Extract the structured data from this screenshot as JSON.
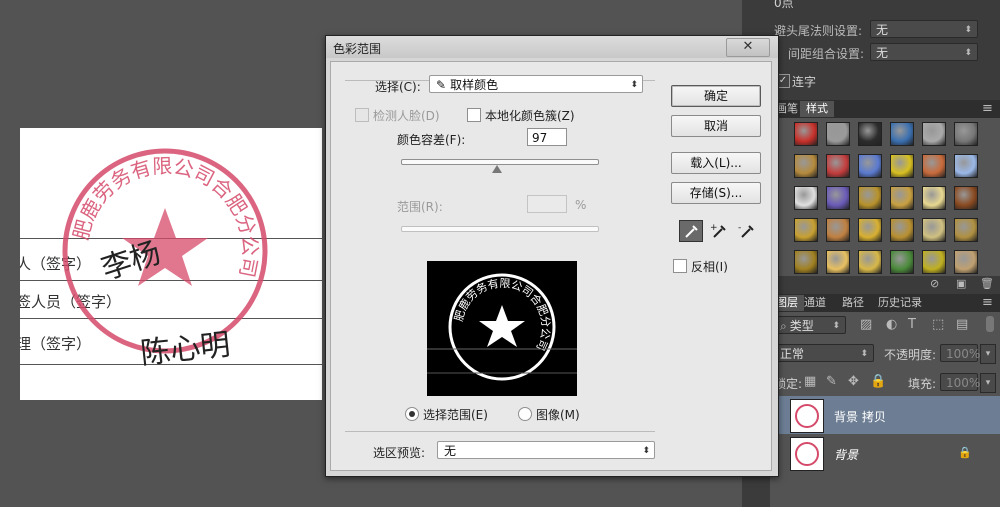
{
  "doc_text": {
    "stamp_text": "肥鹿劳务有限公司合肥分公司",
    "row1": "人（签字）",
    "row2": "签人员（签字）",
    "row3": "理（签字）",
    "sig1": "李杨",
    "sig2": "陈心明"
  },
  "dialog": {
    "title": "色彩范围",
    "close": "✕",
    "select_label": "选择(C):",
    "select_value": "取样颜色",
    "detect_faces": "检测人脸(D)",
    "localized": "本地化颜色簇(Z)",
    "fuzziness_label": "颜色容差(F):",
    "fuzziness_value": "97",
    "fuzziness_level": 0.49,
    "range_label": "范围(R):",
    "range_value": "",
    "percent": "%",
    "radio_selection": "选择范围(E)",
    "radio_image": "图像(M)",
    "preview_label": "选区预览:",
    "preview_value": "无",
    "buttons": {
      "ok": "确定",
      "cancel": "取消",
      "load": "载入(L)...",
      "save": "存储(S)..."
    },
    "invert": "反相(I)",
    "preview_stamp_text": "肥鹿劳务有限公司合肥分公司"
  },
  "panel": {
    "top_value_1": "0点",
    "top_value_2": "0点",
    "kinsoku_label": "避头尾法则设置:",
    "kinsoku_value": "无",
    "mojikumi_label": "间距组合设置:",
    "mojikumi_value": "无",
    "ligature": "连字",
    "tab_brush": "画笔",
    "tab_styles": "样式",
    "tab_layers": "图层",
    "tab_channels": "通道",
    "tab_paths": "路径",
    "tab_history": "历史记录",
    "filter_kind": "类型",
    "blend_mode": "正常",
    "opacity_label": "不透明度:",
    "opacity_value": "100%",
    "lock_label": "锁定:",
    "fill_label": "填充:",
    "fill_value": "100%",
    "layers": [
      {
        "name": "背景 拷贝",
        "locked": false
      },
      {
        "name": "背景",
        "locked": true
      }
    ]
  },
  "colors": {
    "stamp_red": "#d54a6a",
    "layer_selected": "#6d7e94"
  }
}
